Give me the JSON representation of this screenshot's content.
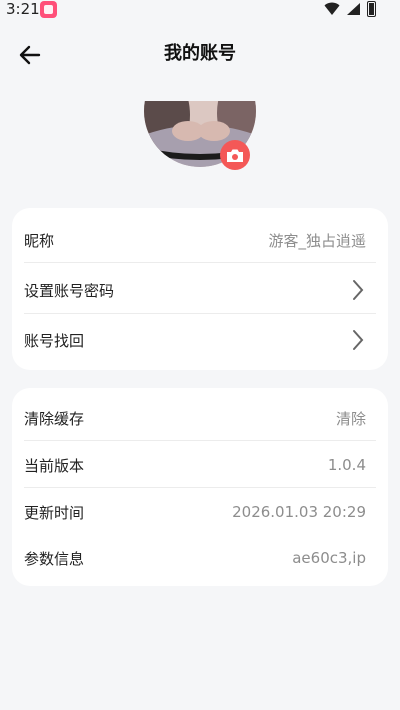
{
  "status_bar": {
    "time": "3:21",
    "icons": [
      "app-notification-icon",
      "wifi-icon",
      "signal-icon",
      "battery-icon"
    ]
  },
  "header": {
    "title": "我的账号",
    "back_icon": "back-arrow-icon"
  },
  "avatar": {
    "camera_icon": "camera-icon",
    "accent_color": "#f45857"
  },
  "account_card": {
    "items": [
      {
        "label": "昵称",
        "value": "游客_独占逍遥"
      },
      {
        "label": "设置账号密码",
        "icon": "chevron-right-icon"
      },
      {
        "label": "账号找回",
        "icon": "chevron-right-icon"
      }
    ]
  },
  "settings_card": {
    "items": [
      {
        "label": "清除缓存",
        "value": "清除"
      },
      {
        "label": "当前版本",
        "value": "1.0.4"
      },
      {
        "label": "更新时间",
        "value": "2026.01.03 20:29"
      },
      {
        "label": "参数信息",
        "value": "ae60c3,ip"
      }
    ]
  },
  "colors": {
    "background": "#f5f6f8",
    "card": "#ffffff",
    "secondary_text": "#8d8d8d"
  }
}
